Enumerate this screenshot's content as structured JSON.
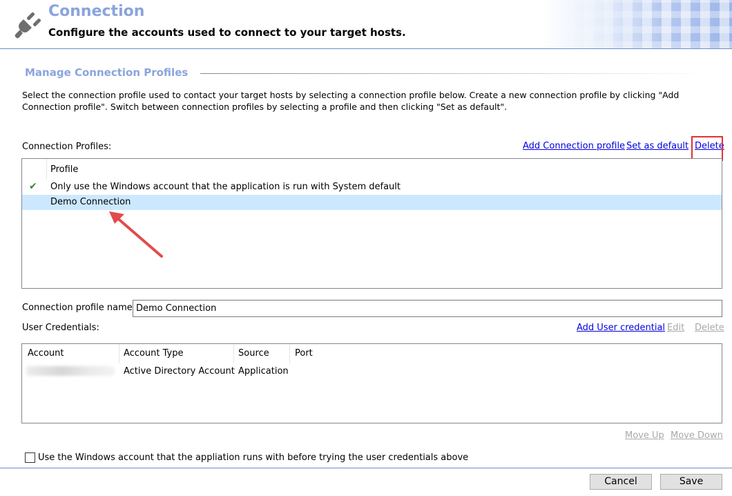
{
  "header": {
    "title": "Connection",
    "subtitle": "Configure the accounts used to connect to your target hosts."
  },
  "section": {
    "title": "Manage Connection Profiles",
    "description": "Select the connection profile used to contact your target hosts by selecting a connection profile below. Create a new connection profile by clicking \"Add Connection profile\". Switch between connection profiles by selecting a profile and then clicking \"Set as default\"."
  },
  "profiles": {
    "label": "Connection Profiles:",
    "actions": {
      "add": "Add Connection profile",
      "set_default": "Set as default",
      "delete": "Delete"
    },
    "column_header": "Profile",
    "rows": [
      {
        "name": "Only use the Windows account that the application is run with System default",
        "is_default": true
      },
      {
        "name": "Demo Connection",
        "selected": true
      }
    ]
  },
  "profile_name": {
    "label": "Connection profile name:",
    "value": "Demo Connection"
  },
  "credentials": {
    "label": "User Credentials:",
    "actions": {
      "add": "Add User credential",
      "edit": "Edit",
      "delete": "Delete"
    },
    "columns": [
      "Account",
      "Account Type",
      "Source",
      "Port"
    ],
    "rows": [
      {
        "account": "",
        "account_type": "Active Directory Account",
        "source": "Application",
        "port": ""
      }
    ],
    "move_up": "Move Up",
    "move_down": "Move Down"
  },
  "checkbox": {
    "label": "Use the Windows account that the appliation runs with before trying the user credentials above",
    "checked": false
  },
  "buttons": {
    "cancel": "Cancel",
    "save": "Save"
  },
  "colors": {
    "accent_title": "#8aa4dd",
    "link": "#0000e0",
    "selected_row": "#cce8ff",
    "highlight": "#e03131"
  }
}
